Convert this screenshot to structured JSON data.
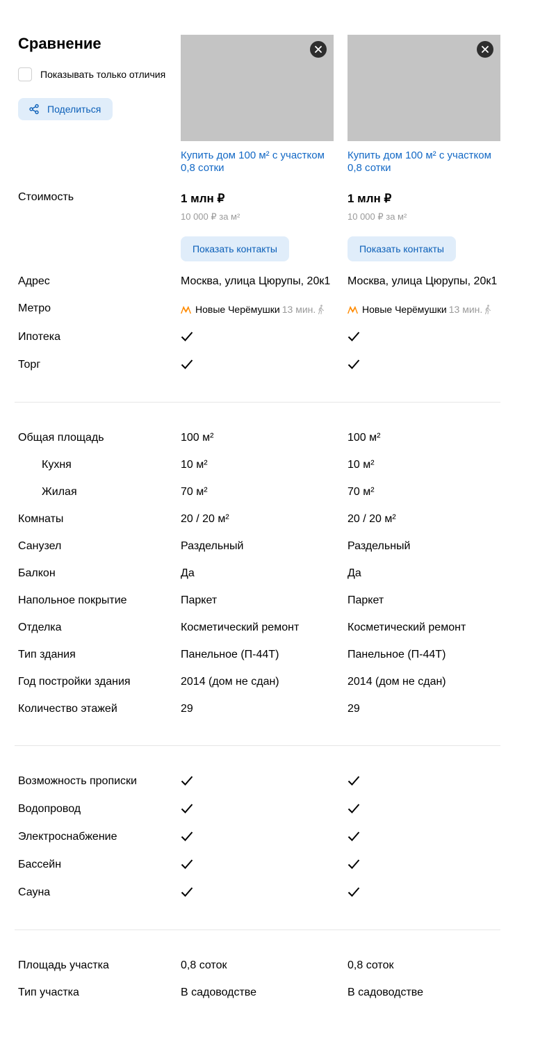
{
  "page": {
    "title": "Сравнение",
    "diff_only_label": "Показывать только отличия",
    "share_label": "Поделиться"
  },
  "labels": {
    "price": "Стоимость",
    "address": "Адрес",
    "metro": "Метро",
    "mortgage": "Ипотека",
    "haggle": "Торг",
    "total_area": "Общая площадь",
    "kitchen": "Кухня",
    "living": "Жилая",
    "rooms": "Комнаты",
    "bathroom": "Санузел",
    "balcony": "Балкон",
    "floor_covering": "Напольное покрытие",
    "renovation": "Отделка",
    "building_type": "Тип здания",
    "build_year": "Год постройки здания",
    "floors_count": "Количество этажей",
    "registration": "Возможность прописки",
    "water": "Водопровод",
    "electricity": "Электроснабжение",
    "pool": "Бассейн",
    "sauna": "Сауна",
    "lot_area": "Площадь участка",
    "lot_type": "Тип участка"
  },
  "offers": [
    {
      "title": "Купить дом 100 м² с участком 0,8 сотки",
      "price": "1 млн ₽",
      "price_per_meter": "10 000 ₽ за м²",
      "contacts_label": "Показать контакты",
      "address": "Москва, улица Цюрупы, 20к1",
      "metro_station": "Новые Черёмушки",
      "metro_time": "13 мин.",
      "mortgage": true,
      "haggle": true,
      "total_area": "100 м²",
      "kitchen": "10 м²",
      "living": "70 м²",
      "rooms": "20 / 20 м²",
      "bathroom": "Раздельный",
      "balcony": "Да",
      "floor_covering": "Паркет",
      "renovation": "Косметический ремонт",
      "building_type": "Панельное (П-44Т)",
      "build_year": "2014 (дом не сдан)",
      "floors_count": "29",
      "registration": true,
      "water": true,
      "electricity": true,
      "pool": true,
      "sauna": true,
      "lot_area": "0,8 соток",
      "lot_type": "В садоводстве"
    },
    {
      "title": "Купить дом 100 м² с участком 0,8 сотки",
      "price": "1 млн ₽",
      "price_per_meter": "10 000 ₽ за м²",
      "contacts_label": "Показать контакты",
      "address": "Москва, улица Цюрупы, 20к1",
      "metro_station": "Новые Черёмушки",
      "metro_time": "13 мин.",
      "mortgage": true,
      "haggle": true,
      "total_area": "100 м²",
      "kitchen": "10 м²",
      "living": "70 м²",
      "rooms": "20 / 20 м²",
      "bathroom": "Раздельный",
      "balcony": "Да",
      "floor_covering": "Паркет",
      "renovation": "Косметический ремонт",
      "building_type": "Панельное (П-44Т)",
      "build_year": "2014 (дом не сдан)",
      "floors_count": "29",
      "registration": true,
      "water": true,
      "electricity": true,
      "pool": true,
      "sauna": true,
      "lot_area": "0,8 соток",
      "lot_type": "В садоводстве"
    }
  ],
  "colors": {
    "link": "#1268c5",
    "button_bg": "#e0edfa",
    "metro": "#ff8a00",
    "muted": "#9a9a9a"
  }
}
